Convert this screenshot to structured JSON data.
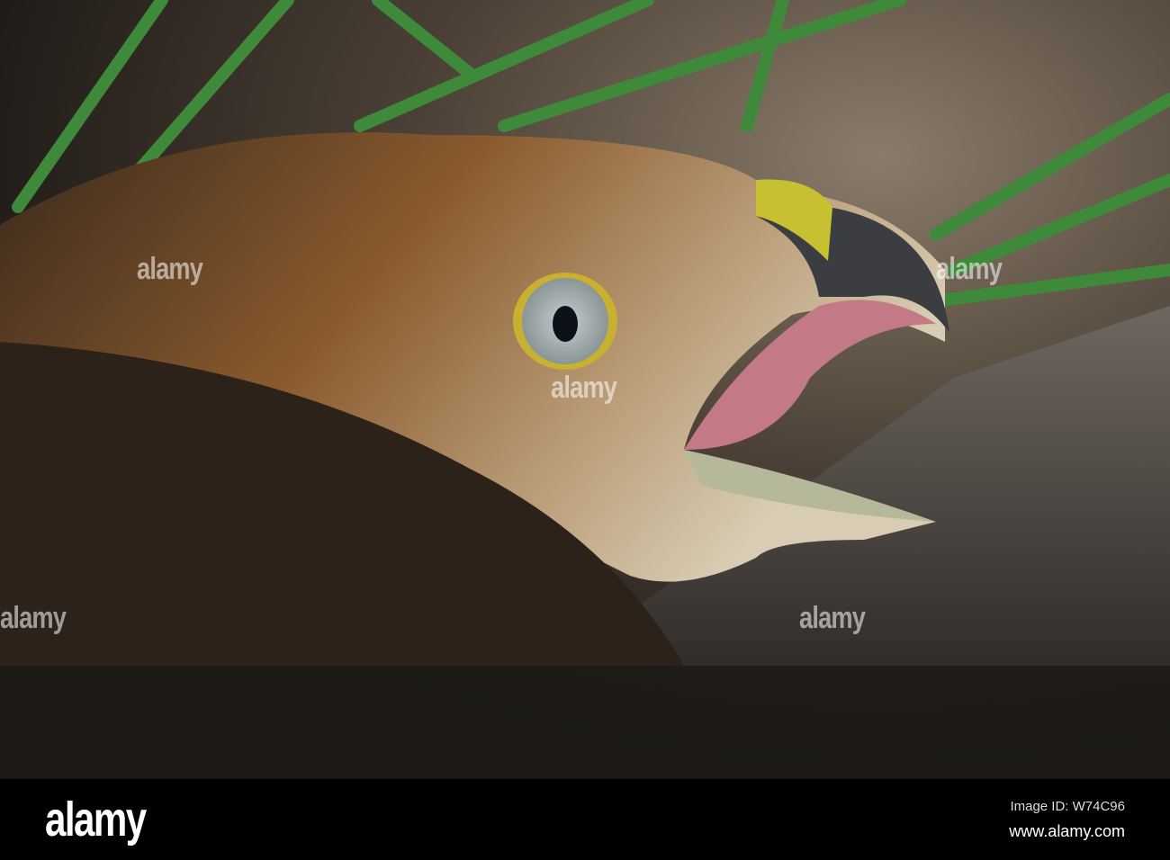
{
  "photo": {
    "subject": "hawk-head-open-beak",
    "watermark_text": "alamy"
  },
  "footer": {
    "logo": "alamy",
    "image_id": "Image ID: W74C96",
    "website": "www.alamy.com"
  }
}
